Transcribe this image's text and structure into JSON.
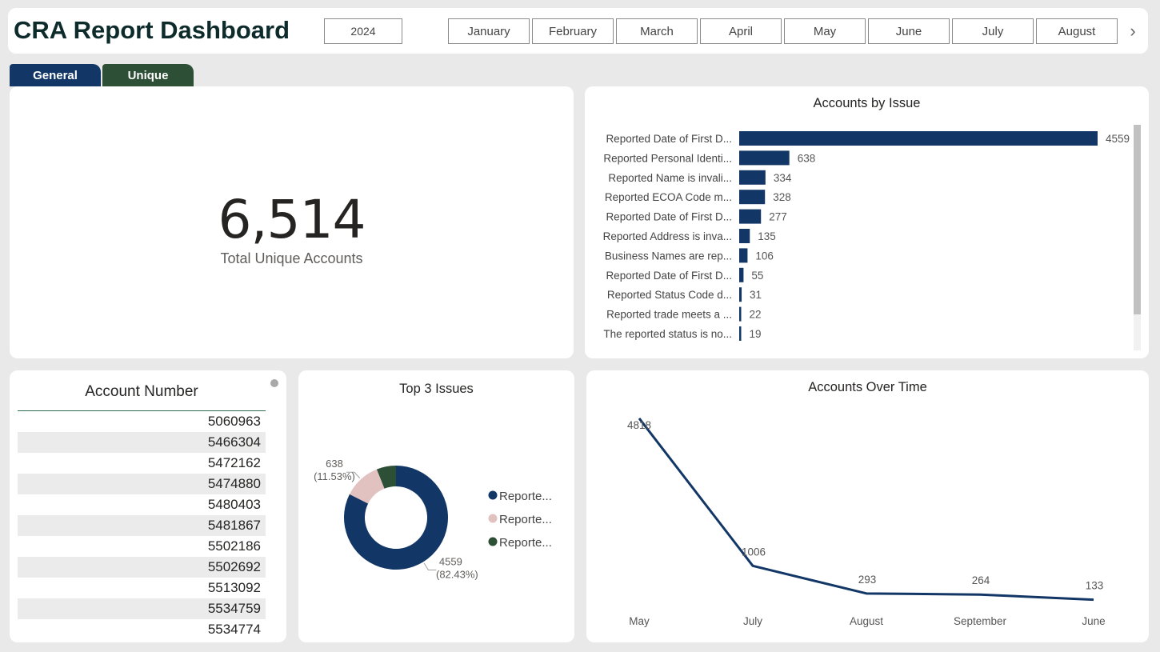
{
  "header": {
    "title": "CRA Report Dashboard",
    "year": "2024",
    "months": [
      "January",
      "February",
      "March",
      "April",
      "May",
      "June",
      "July",
      "August"
    ],
    "next_icon": "chevron-right-icon"
  },
  "tabs": [
    {
      "label": "General",
      "color": "#123766"
    },
    {
      "label": "Unique",
      "color": "#2d4f35"
    }
  ],
  "kpi": {
    "value": "6,514",
    "label": "Total Unique Accounts"
  },
  "account_table": {
    "header": "Account Number",
    "rows": [
      "5060963",
      "5466304",
      "5472162",
      "5474880",
      "5480403",
      "5481867",
      "5502186",
      "5502692",
      "5513092",
      "5534759",
      "5534774"
    ]
  },
  "colors": {
    "navy": "#123766",
    "pink": "#e2c1c1",
    "green": "#2d4f35"
  },
  "chart_data": [
    {
      "type": "bar",
      "orientation": "horizontal",
      "title": "Accounts by Issue",
      "categories": [
        "Reported Date of First D...",
        "Reported Personal Identi...",
        "Reported Name is invali...",
        "Reported ECOA Code m...",
        "Reported Date of First D...",
        "Reported Address is inva...",
        "Business Names are rep...",
        "Reported Date of First D...",
        "Reported Status Code d...",
        "Reported trade meets a ...",
        "The reported status is no..."
      ],
      "values": [
        4559,
        638,
        334,
        328,
        277,
        135,
        106,
        55,
        31,
        22,
        19
      ],
      "data_labels": true
    },
    {
      "type": "pie",
      "variant": "donut",
      "title": "Top 3 Issues",
      "slices": [
        {
          "legend": "Reporte...",
          "value": 4559,
          "label_value": "4559",
          "label_pct": "(82.43%)",
          "color": "#123766"
        },
        {
          "legend": "Reporte...",
          "value": 638,
          "label_value": "638",
          "label_pct": "(11.53%)",
          "color": "#e2c1c1"
        },
        {
          "legend": "Reporte...",
          "value": 334,
          "color": "#2d4f35"
        }
      ],
      "legend_position": "right"
    },
    {
      "type": "line",
      "title": "Accounts Over Time",
      "categories": [
        "May",
        "July",
        "August",
        "September",
        "June"
      ],
      "values": [
        4818,
        1006,
        293,
        264,
        133
      ],
      "data_labels": true
    }
  ]
}
